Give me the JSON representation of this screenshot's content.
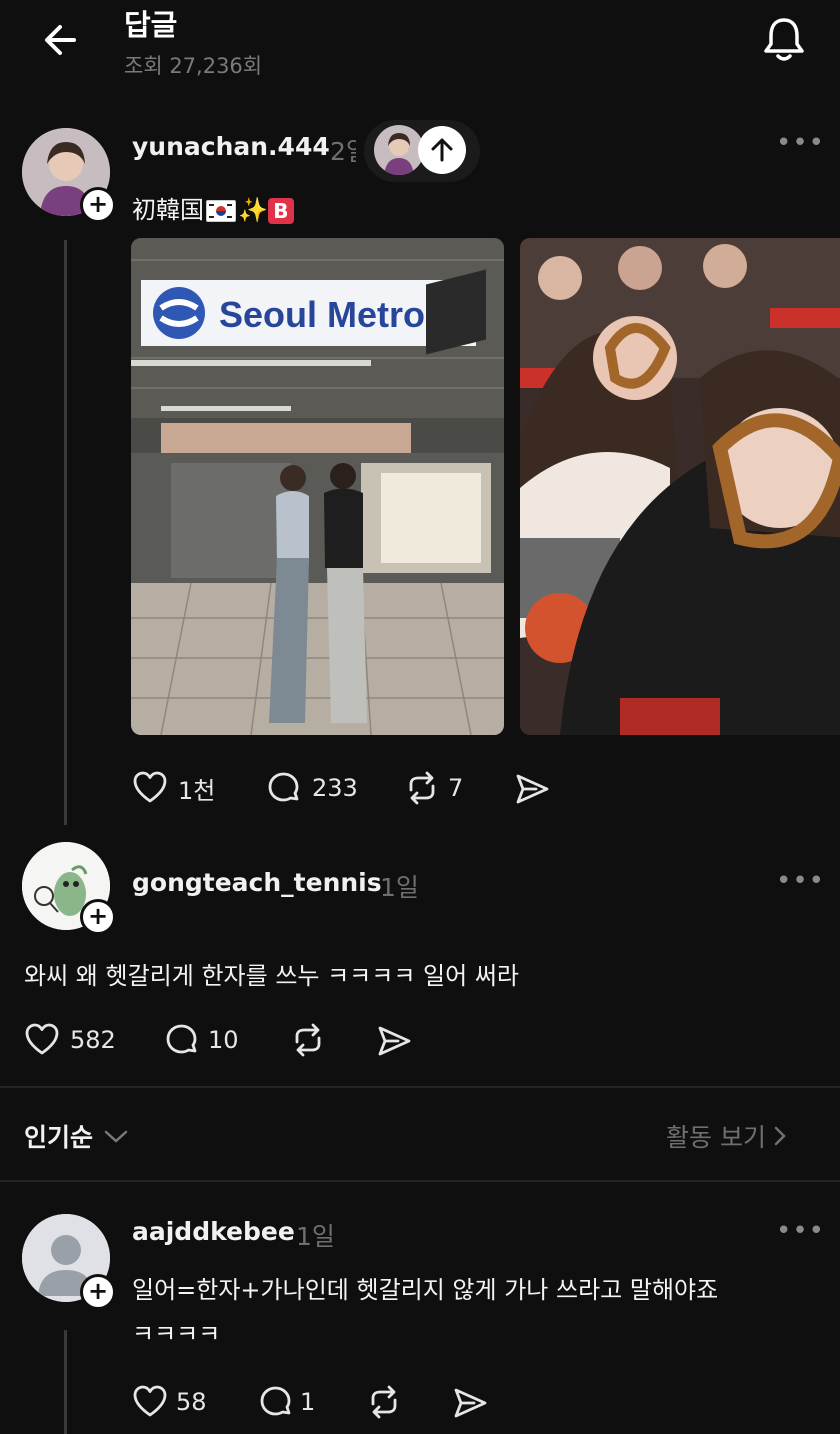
{
  "header": {
    "title": "답글",
    "views": "조회 27,236회"
  },
  "post": {
    "username": "yunachan.444",
    "time": "2일",
    "text_prefix": "初韓国",
    "text_sparkle": "✨",
    "text_badge": "B",
    "image1_sign": "Seoul Metro",
    "likes": "1천",
    "comments": "233",
    "reposts": "7"
  },
  "reply1": {
    "username": "gongteach_tennis",
    "time": "1일",
    "text": "와씨 왜 헷갈리게 한자를 쓰누 ㅋㅋㅋㅋ 일어 써라",
    "likes": "582",
    "comments": "10"
  },
  "sort": {
    "label": "인기순",
    "activity_link": "활동 보기"
  },
  "reply2": {
    "username": "aajddkebee",
    "time": "1일",
    "text_line1": "일어=한자+가나인데 헷갈리지 않게 가나 쓰라고 말해야죠",
    "text_line2": "ㅋㅋㅋㅋ",
    "likes": "58",
    "comments": "1"
  },
  "icons": {
    "back": "arrow-left-icon",
    "bell": "bell-icon",
    "like": "heart-icon",
    "comment": "comment-bubble-icon",
    "repost": "repost-icon",
    "share": "send-icon",
    "more": "more-dots-icon"
  }
}
